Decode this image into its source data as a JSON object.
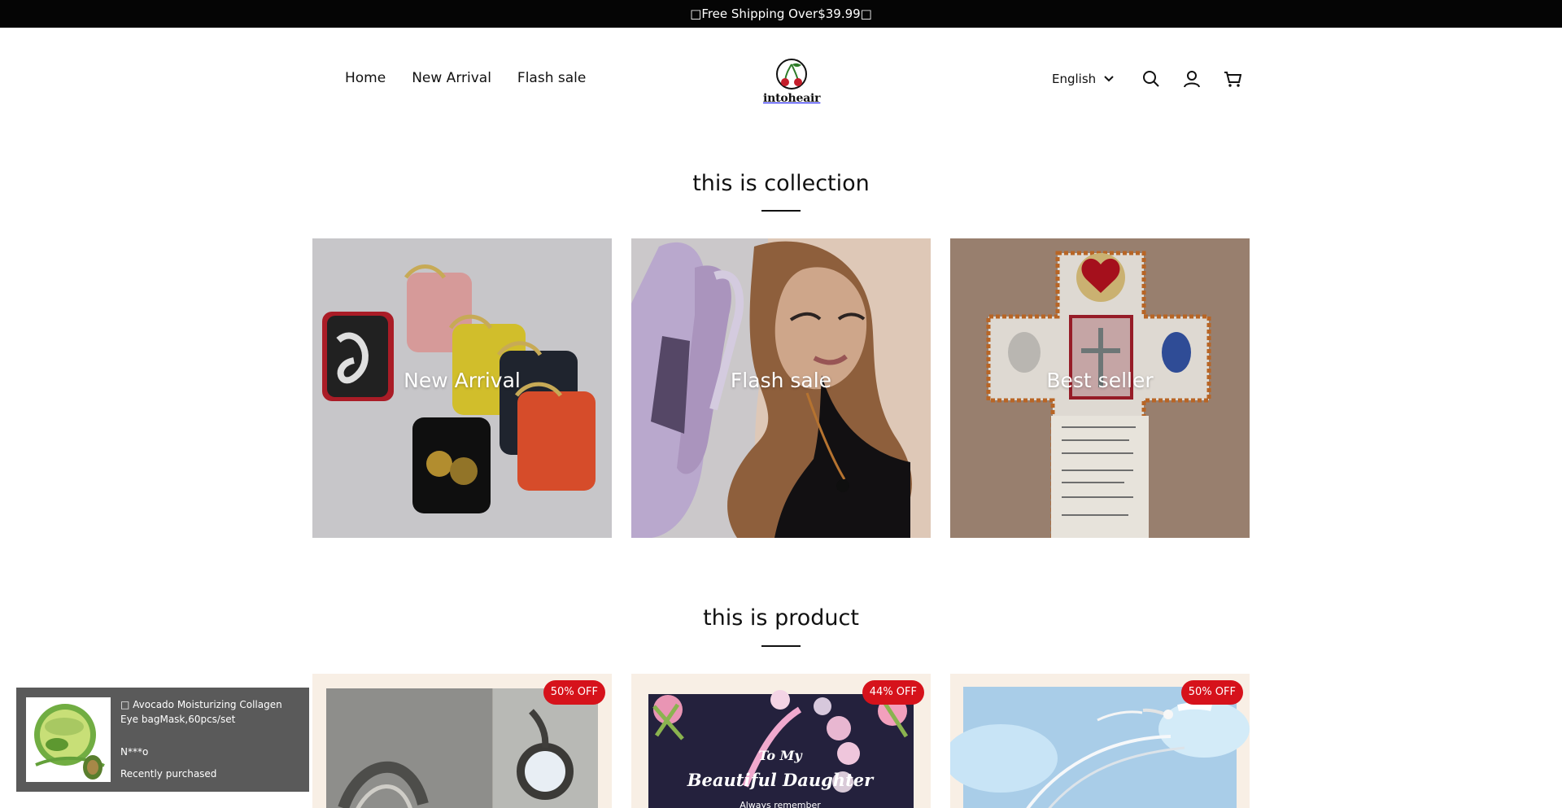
{
  "announcement": "□Free Shipping Over$39.99□",
  "nav": {
    "home": "Home",
    "new_arrival": "New Arrival",
    "flash_sale": "Flash sale"
  },
  "logo": {
    "text": "intoheair",
    "icon": "cherry-logo-icon",
    "accent": "#c41e2b",
    "leaf": "#2f7d2a"
  },
  "language": {
    "selected": "English",
    "icon": "chevron-down-icon"
  },
  "header_icons": [
    "search-icon",
    "account-icon",
    "cart-icon"
  ],
  "collection_section": {
    "title": "this is collection",
    "cards": [
      {
        "label": "New Arrival"
      },
      {
        "label": "Flash sale"
      },
      {
        "label": "Best seller"
      }
    ]
  },
  "product_section": {
    "title": "this is product",
    "products": [
      {
        "badge": "50% OFF"
      },
      {
        "badge": "44% OFF",
        "image_text_1": "To My",
        "image_text_2": "Beautiful Daughter",
        "image_text_3": "Always remember"
      },
      {
        "badge": "50% OFF"
      }
    ]
  },
  "popup": {
    "product": "□ Avocado Moisturizing Collagen Eye bagMask,60pcs/set",
    "buyer": "N***o",
    "status": "Recently purchased"
  },
  "colors": {
    "badge": "#d6121b",
    "announcement_bg": "#050505",
    "popup_bg": "#5a5a5a",
    "product_bg": "#f8efe5"
  }
}
